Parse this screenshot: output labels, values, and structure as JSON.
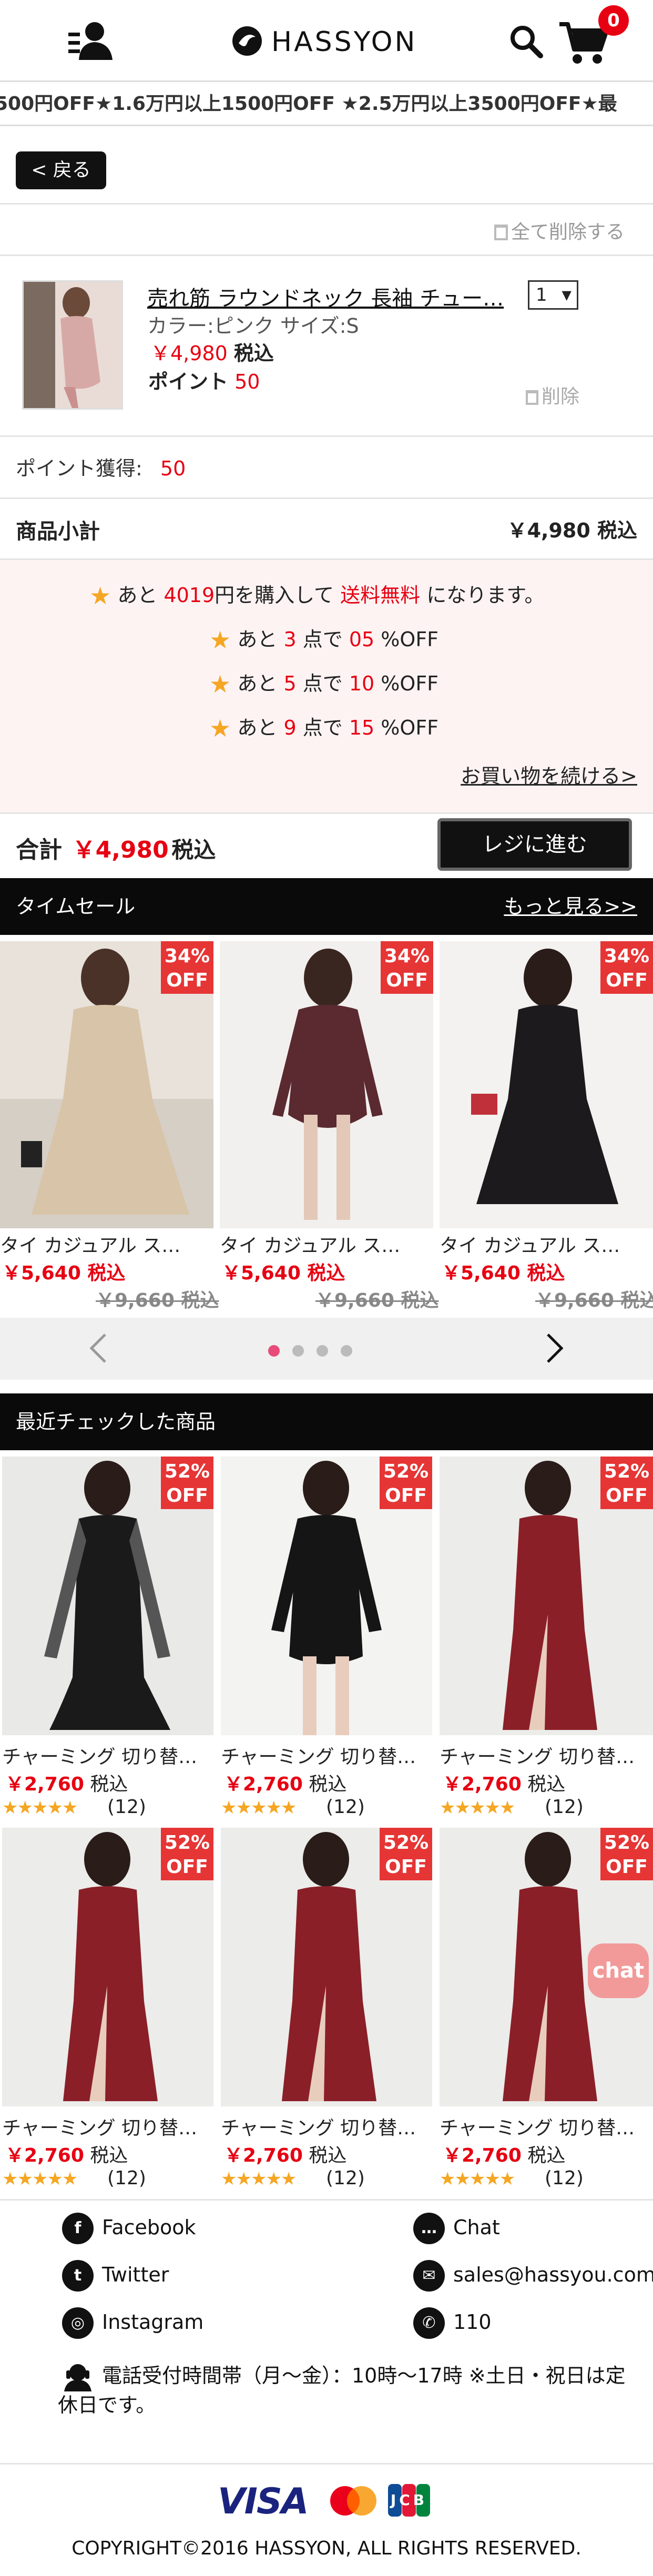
{
  "header": {
    "brand": "HASSYON",
    "cart_count": "0"
  },
  "marquee": {
    "text": "500円OFF★1.6万円以上1500円OFF ★2.5万円以上3500円OFF★最"
  },
  "nav": {
    "back_label": "< 戻る"
  },
  "cart": {
    "delete_all_label": "全て削除する",
    "item": {
      "name": "売れ筋 ラウンドネック 長袖 チュー…",
      "variant": "カラー:ピンク サイズ:S",
      "price": "￥4,980",
      "tax_label": "税込",
      "point_label": "ポイント",
      "point_value": "50",
      "quantity": "1",
      "delete_label": "削除"
    },
    "points_earned_label": "ポイント獲得:",
    "points_earned_value": "50",
    "subtotal_label": "商品小計",
    "subtotal_value": "￥4,980 税込"
  },
  "promo": {
    "line1_prefix": "あと",
    "line1_amount": "4019",
    "line1_mid": "円を購入して",
    "line1_free": "送料無料",
    "line1_suffix": "になります。",
    "tiers": [
      {
        "prefix": "あと",
        "count": "3",
        "mid": "点で",
        "pct": "05",
        "suffix": "%OFF"
      },
      {
        "prefix": "あと",
        "count": "5",
        "mid": "点で",
        "pct": "10",
        "suffix": "%OFF"
      },
      {
        "prefix": "あと",
        "count": "9",
        "mid": "点で",
        "pct": "15",
        "suffix": "%OFF"
      }
    ],
    "continue_link": "お買い物を続ける>"
  },
  "total": {
    "label": "合計",
    "value": "￥4,980",
    "tax_label": "税込",
    "checkout_label": "レジに進む"
  },
  "time_sale": {
    "title": "タイムセール",
    "more_link": "もっと見る>>",
    "items": [
      {
        "badge_pct": "34%",
        "badge_off": "OFF",
        "name": "タイ カジュアル ス…",
        "price": "￥5,640 税込",
        "old_price": "￥9,660 税込",
        "color": "#d8c4a8"
      },
      {
        "badge_pct": "34%",
        "badge_off": "OFF",
        "name": "タイ カジュアル ス…",
        "price": "￥5,640 税込",
        "old_price": "￥9,660 税込",
        "color": "#5a2a30"
      },
      {
        "badge_pct": "34%",
        "badge_off": "OFF",
        "name": "タイ カジュアル ス…",
        "price": "￥5,640 税込",
        "old_price": "￥9,660 税込",
        "color": "#1c1a1c"
      }
    ],
    "carousel_active_dot": 1,
    "carousel_dots": 4
  },
  "recent": {
    "title": "最近チェックした商品",
    "items": [
      {
        "badge_pct": "52%",
        "badge_off": "OFF",
        "name": "チャーミング 切り替…",
        "price": "￥2,760",
        "tax": "税込",
        "stars": "★★★★★",
        "reviews": "(12)",
        "color": "#1a1a1a"
      },
      {
        "badge_pct": "52%",
        "badge_off": "OFF",
        "name": "チャーミング 切り替…",
        "price": "￥2,760",
        "tax": "税込",
        "stars": "★★★★★",
        "reviews": "(12)",
        "color": "#151515"
      },
      {
        "badge_pct": "52%",
        "badge_off": "OFF",
        "name": "チャーミング 切り替…",
        "price": "￥2,760",
        "tax": "税込",
        "stars": "★★★★★",
        "reviews": "(12)",
        "color": "#8a1f28"
      },
      {
        "badge_pct": "52%",
        "badge_off": "OFF",
        "name": "チャーミング 切り替…",
        "price": "￥2,760",
        "tax": "税込",
        "stars": "★★★★★",
        "reviews": "(12)",
        "color": "#8a1f28"
      },
      {
        "badge_pct": "52%",
        "badge_off": "OFF",
        "name": "チャーミング 切り替…",
        "price": "￥2,760",
        "tax": "税込",
        "stars": "★★★★★",
        "reviews": "(12)",
        "color": "#8a1f28"
      },
      {
        "badge_pct": "52%",
        "badge_off": "OFF",
        "name": "チャーミング 切り替…",
        "price": "￥2,760",
        "tax": "税込",
        "stars": "★★★★★",
        "reviews": "(12)",
        "color": "#8a1f28"
      }
    ],
    "chat_bubble": "chat"
  },
  "footer": {
    "facebook": "Facebook",
    "twitter": "Twitter",
    "instagram": "Instagram",
    "chat": "Chat",
    "email": "sales@hassyou.com",
    "phone": "110",
    "hours": "電話受付時間帯（月～金）：10時～17時 ※土日・祝日は定休日です。",
    "payment_visa": "VISA",
    "payment_jcb": "JCB",
    "copyright": "COPYRIGHT©2016 HASSYON, ALL RIGHTS RESERVED."
  },
  "colors": {
    "accent_red": "#e60012",
    "badge_red": "#e63535",
    "star": "#f5a623",
    "promo_bg": "#fdf3f3"
  }
}
